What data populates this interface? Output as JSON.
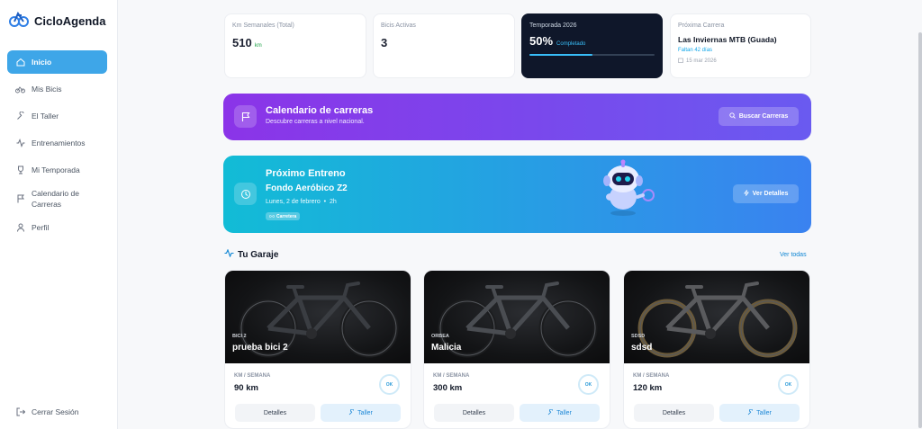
{
  "app": {
    "name": "CicloAgenda"
  },
  "sidebar": {
    "items": [
      {
        "label": "Inicio",
        "icon": "home-icon"
      },
      {
        "label": "Mis Bicis",
        "icon": "bike-icon"
      },
      {
        "label": "El Taller",
        "icon": "wrench-icon"
      },
      {
        "label": "Entrenamientos",
        "icon": "activity-icon"
      },
      {
        "label": "Mi Temporada",
        "icon": "trophy-icon"
      },
      {
        "label": "Calendario de Carreras",
        "icon": "flag-icon"
      },
      {
        "label": "Perfil",
        "icon": "user-icon"
      }
    ],
    "logout": "Cerrar Sesión"
  },
  "stats": {
    "km": {
      "label": "Km Semanales (Total)",
      "value": "510",
      "unit": "km"
    },
    "bikes": {
      "label": "Bicis Activas",
      "value": "3"
    },
    "season": {
      "label": "Temporada 2026",
      "value": "50%",
      "sub": "Completado",
      "progress": 0.5
    },
    "next_race": {
      "label": "Próxima Carrera",
      "name": "Las Inviernas MTB (Guada)",
      "days": "Faltan 42 días",
      "date": "15 mar 2026"
    }
  },
  "calendar_banner": {
    "title": "Calendario de carreras",
    "subtitle": "Descubre carreras a nivel nacional.",
    "button": "Buscar Carreras"
  },
  "training_banner": {
    "title": "Próximo Entreno",
    "workout": "Fondo Aeróbico Z2",
    "when": "Lunes, 2 de febrero",
    "duration": "2h",
    "tag": "Carretera",
    "button": "Ver Detalles"
  },
  "garage": {
    "title": "Tu Garaje",
    "see_all": "Ver todas",
    "bikes": [
      {
        "brand": "BICI 2",
        "name": "prueba bici 2",
        "km_label": "KM / SEMANA",
        "km": "90 km",
        "status": "OK",
        "details": "Detalles",
        "workshop": "Taller"
      },
      {
        "brand": "ORBEA",
        "name": "Malicia",
        "km_label": "KM / SEMANA",
        "km": "300 km",
        "status": "OK",
        "details": "Detalles",
        "workshop": "Taller"
      },
      {
        "brand": "SDSD",
        "name": "sdsd",
        "km_label": "KM / SEMANA",
        "km": "120 km",
        "status": "OK",
        "details": "Detalles",
        "workshop": "Taller"
      }
    ]
  },
  "colors": {
    "accent": "#3ea6e8",
    "purple_start": "#8b34e8",
    "blue_start": "#12bcd6",
    "dark_card": "#0f172a"
  }
}
